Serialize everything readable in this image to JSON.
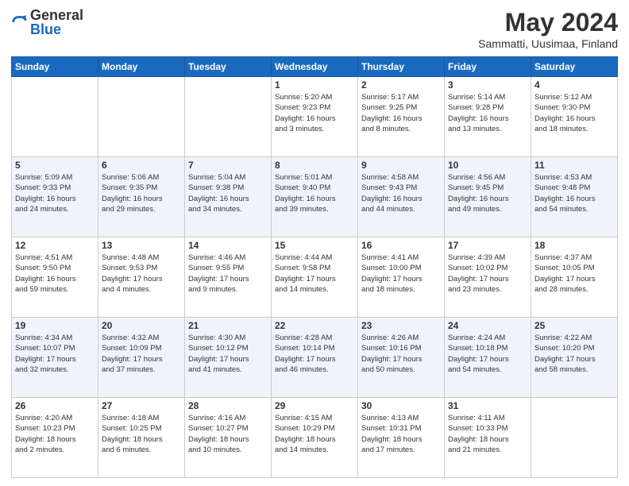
{
  "logo": {
    "general": "General",
    "blue": "Blue"
  },
  "header": {
    "month": "May 2024",
    "location": "Sammatti, Uusimaa, Finland"
  },
  "weekdays": [
    "Sunday",
    "Monday",
    "Tuesday",
    "Wednesday",
    "Thursday",
    "Friday",
    "Saturday"
  ],
  "weeks": [
    [
      {
        "day": "",
        "info": ""
      },
      {
        "day": "",
        "info": ""
      },
      {
        "day": "",
        "info": ""
      },
      {
        "day": "1",
        "info": "Sunrise: 5:20 AM\nSunset: 9:23 PM\nDaylight: 16 hours\nand 3 minutes."
      },
      {
        "day": "2",
        "info": "Sunrise: 5:17 AM\nSunset: 9:25 PM\nDaylight: 16 hours\nand 8 minutes."
      },
      {
        "day": "3",
        "info": "Sunrise: 5:14 AM\nSunset: 9:28 PM\nDaylight: 16 hours\nand 13 minutes."
      },
      {
        "day": "4",
        "info": "Sunrise: 5:12 AM\nSunset: 9:30 PM\nDaylight: 16 hours\nand 18 minutes."
      }
    ],
    [
      {
        "day": "5",
        "info": "Sunrise: 5:09 AM\nSunset: 9:33 PM\nDaylight: 16 hours\nand 24 minutes."
      },
      {
        "day": "6",
        "info": "Sunrise: 5:06 AM\nSunset: 9:35 PM\nDaylight: 16 hours\nand 29 minutes."
      },
      {
        "day": "7",
        "info": "Sunrise: 5:04 AM\nSunset: 9:38 PM\nDaylight: 16 hours\nand 34 minutes."
      },
      {
        "day": "8",
        "info": "Sunrise: 5:01 AM\nSunset: 9:40 PM\nDaylight: 16 hours\nand 39 minutes."
      },
      {
        "day": "9",
        "info": "Sunrise: 4:58 AM\nSunset: 9:43 PM\nDaylight: 16 hours\nand 44 minutes."
      },
      {
        "day": "10",
        "info": "Sunrise: 4:56 AM\nSunset: 9:45 PM\nDaylight: 16 hours\nand 49 minutes."
      },
      {
        "day": "11",
        "info": "Sunrise: 4:53 AM\nSunset: 9:48 PM\nDaylight: 16 hours\nand 54 minutes."
      }
    ],
    [
      {
        "day": "12",
        "info": "Sunrise: 4:51 AM\nSunset: 9:50 PM\nDaylight: 16 hours\nand 59 minutes."
      },
      {
        "day": "13",
        "info": "Sunrise: 4:48 AM\nSunset: 9:53 PM\nDaylight: 17 hours\nand 4 minutes."
      },
      {
        "day": "14",
        "info": "Sunrise: 4:46 AM\nSunset: 9:55 PM\nDaylight: 17 hours\nand 9 minutes."
      },
      {
        "day": "15",
        "info": "Sunrise: 4:44 AM\nSunset: 9:58 PM\nDaylight: 17 hours\nand 14 minutes."
      },
      {
        "day": "16",
        "info": "Sunrise: 4:41 AM\nSunset: 10:00 PM\nDaylight: 17 hours\nand 18 minutes."
      },
      {
        "day": "17",
        "info": "Sunrise: 4:39 AM\nSunset: 10:02 PM\nDaylight: 17 hours\nand 23 minutes."
      },
      {
        "day": "18",
        "info": "Sunrise: 4:37 AM\nSunset: 10:05 PM\nDaylight: 17 hours\nand 28 minutes."
      }
    ],
    [
      {
        "day": "19",
        "info": "Sunrise: 4:34 AM\nSunset: 10:07 PM\nDaylight: 17 hours\nand 32 minutes."
      },
      {
        "day": "20",
        "info": "Sunrise: 4:32 AM\nSunset: 10:09 PM\nDaylight: 17 hours\nand 37 minutes."
      },
      {
        "day": "21",
        "info": "Sunrise: 4:30 AM\nSunset: 10:12 PM\nDaylight: 17 hours\nand 41 minutes."
      },
      {
        "day": "22",
        "info": "Sunrise: 4:28 AM\nSunset: 10:14 PM\nDaylight: 17 hours\nand 46 minutes."
      },
      {
        "day": "23",
        "info": "Sunrise: 4:26 AM\nSunset: 10:16 PM\nDaylight: 17 hours\nand 50 minutes."
      },
      {
        "day": "24",
        "info": "Sunrise: 4:24 AM\nSunset: 10:18 PM\nDaylight: 17 hours\nand 54 minutes."
      },
      {
        "day": "25",
        "info": "Sunrise: 4:22 AM\nSunset: 10:20 PM\nDaylight: 17 hours\nand 58 minutes."
      }
    ],
    [
      {
        "day": "26",
        "info": "Sunrise: 4:20 AM\nSunset: 10:23 PM\nDaylight: 18 hours\nand 2 minutes."
      },
      {
        "day": "27",
        "info": "Sunrise: 4:18 AM\nSunset: 10:25 PM\nDaylight: 18 hours\nand 6 minutes."
      },
      {
        "day": "28",
        "info": "Sunrise: 4:16 AM\nSunset: 10:27 PM\nDaylight: 18 hours\nand 10 minutes."
      },
      {
        "day": "29",
        "info": "Sunrise: 4:15 AM\nSunset: 10:29 PM\nDaylight: 18 hours\nand 14 minutes."
      },
      {
        "day": "30",
        "info": "Sunrise: 4:13 AM\nSunset: 10:31 PM\nDaylight: 18 hours\nand 17 minutes."
      },
      {
        "day": "31",
        "info": "Sunrise: 4:11 AM\nSunset: 10:33 PM\nDaylight: 18 hours\nand 21 minutes."
      },
      {
        "day": "",
        "info": ""
      }
    ]
  ]
}
